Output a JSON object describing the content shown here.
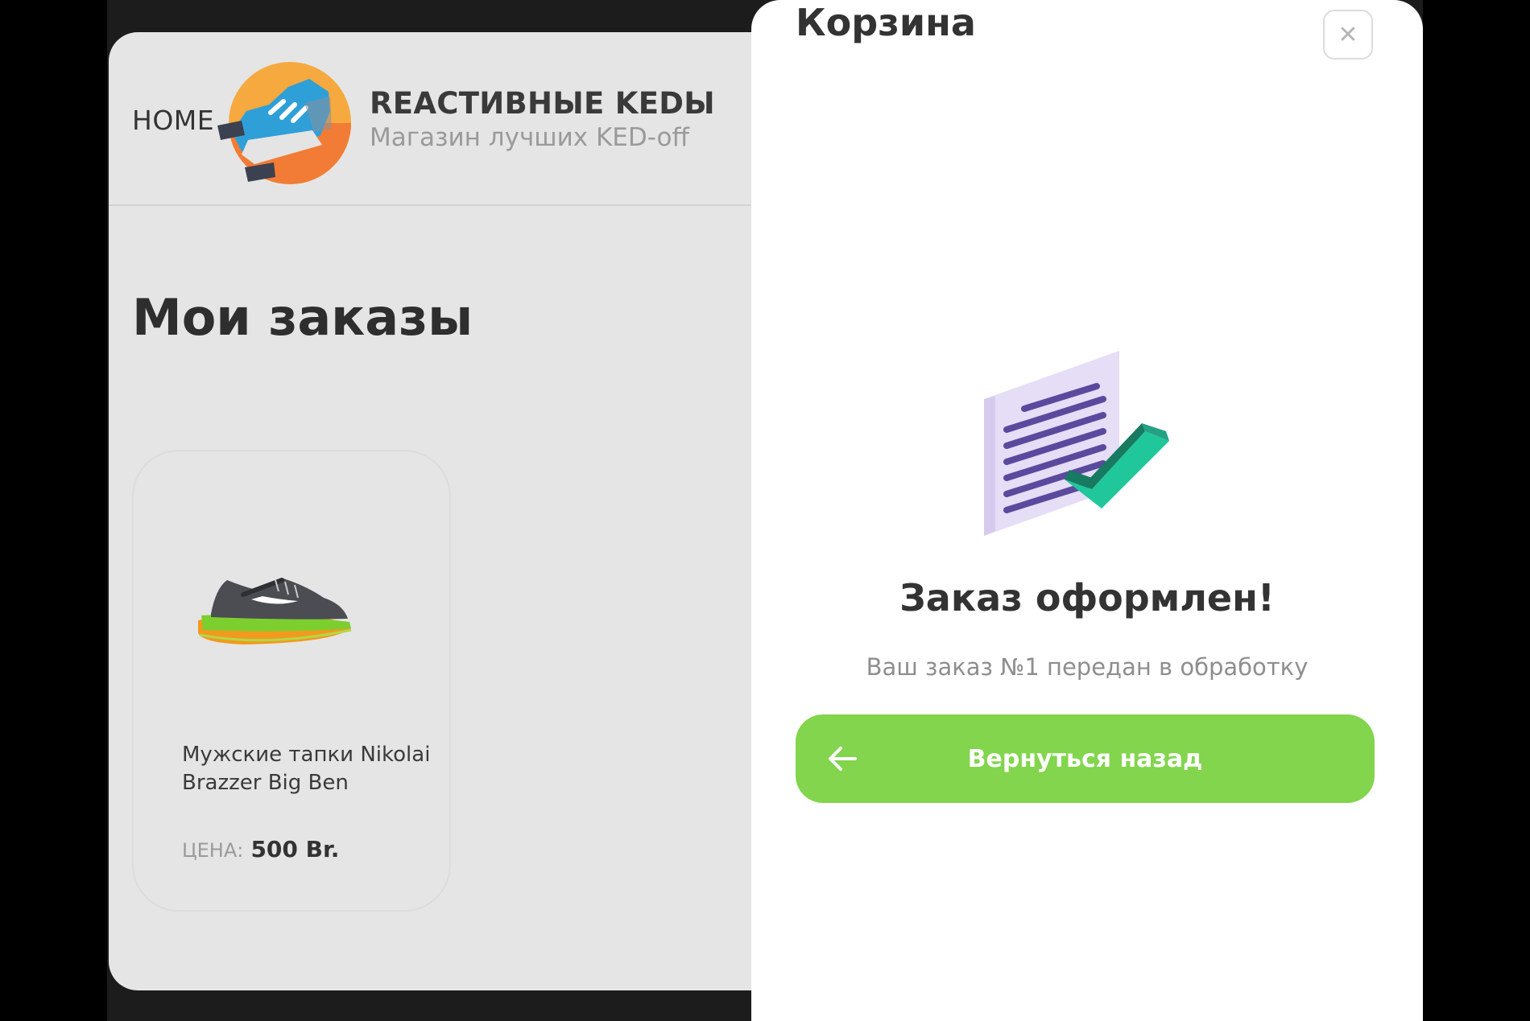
{
  "header": {
    "home_label": "HOME",
    "brand_title": "REACTИВНЫЕ KEDЫ",
    "brand_subtitle": "Магазин лучших KED-off"
  },
  "main": {
    "page_title": "Мои заказы",
    "orders": [
      {
        "name": "Мужские тапки Nikolai Brazzer Big Ben",
        "price_label": "ЦЕНА:",
        "price_value": "500 Br."
      }
    ]
  },
  "cart": {
    "title": "Корзина",
    "close_icon": "close-icon",
    "heading": "Заказ оформлен!",
    "message": "Ваш заказ №1 передан в обработку",
    "back_label": "Вернуться назад",
    "back_icon": "arrow-left-icon"
  },
  "colors": {
    "accent_green": "#82d54d",
    "page_background": "#e5e5e5",
    "drawer_background": "#ffffff"
  }
}
